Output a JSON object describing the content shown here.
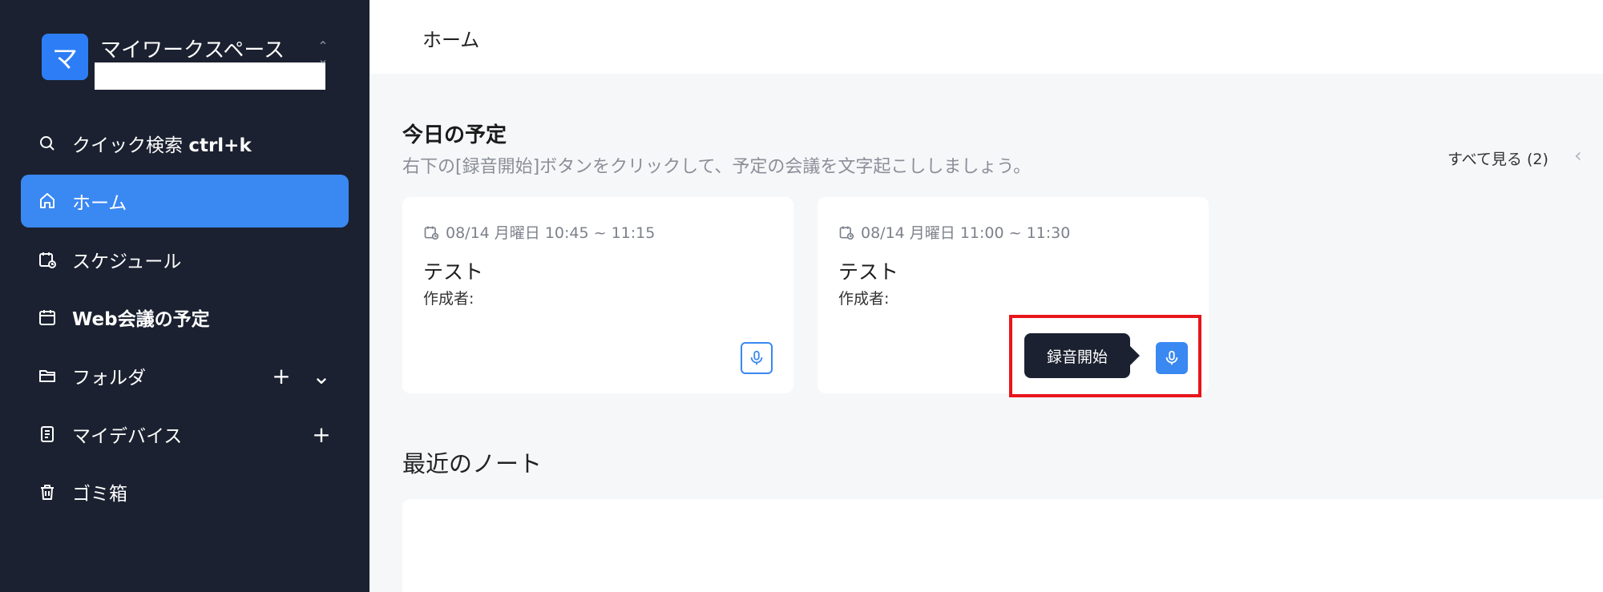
{
  "workspace": {
    "avatar_letter": "マ",
    "name": "マイワークスペース",
    "switch_icon": "chevron-updown-icon"
  },
  "sidebar": {
    "items": [
      {
        "label": "クイック検索 ",
        "shortcut": "ctrl+k",
        "icon": "search-icon"
      },
      {
        "label": "ホーム",
        "icon": "home-icon",
        "active": true
      },
      {
        "label": "スケジュール",
        "icon": "calendar-clock-icon"
      },
      {
        "label": "Web会議の予定",
        "icon": "calendar-icon"
      },
      {
        "label": "フォルダ",
        "icon": "folder-icon",
        "extras": [
          "+",
          "⌄"
        ]
      },
      {
        "label": "マイデバイス",
        "icon": "device-icon",
        "extras": [
          "+"
        ]
      },
      {
        "label": "ゴミ箱",
        "icon": "trash-icon"
      }
    ]
  },
  "header": {
    "breadcrumb": "ホーム"
  },
  "schedule": {
    "title": "今日の予定",
    "subtitle": "右下の[録音開始]ボタンをクリックして、予定の会議を文字起こししましょう。",
    "see_all": "すべて見る (2)",
    "prev_arrow": "‹",
    "cards": [
      {
        "date": "08/14 月曜日 10:45 ~ 11:15",
        "title": "テスト",
        "author": "作成者:"
      },
      {
        "date": "08/14 月曜日 11:00 ~ 11:30",
        "title": "テスト",
        "author": "作成者:"
      }
    ],
    "tooltip": "録音開始"
  },
  "recent": {
    "title": "最近のノート"
  },
  "colors": {
    "accent": "#3a88f2",
    "sidebar_bg": "#1b2130",
    "highlight": "#e8151b"
  }
}
